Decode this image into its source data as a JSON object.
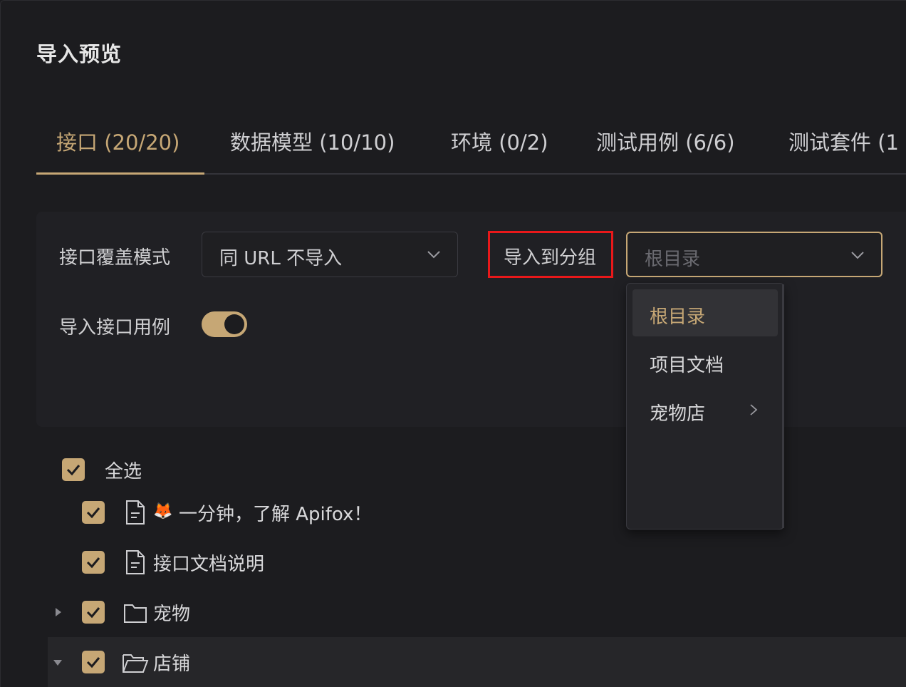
{
  "dialog": {
    "title": "导入预览"
  },
  "tabs": [
    {
      "label": "接口 (20/20)",
      "active": true
    },
    {
      "label": "数据模型 (10/10)",
      "active": false
    },
    {
      "label": "环境 (0/2)",
      "active": false
    },
    {
      "label": "测试用例 (6/6)",
      "active": false
    },
    {
      "label": "测试套件 (1"
    }
  ],
  "settings": {
    "override_mode_label": "接口覆盖模式",
    "override_mode_value": "同 URL 不导入",
    "import_group_label": "导入到分组",
    "import_group_placeholder": "根目录",
    "import_cases_label": "导入接口用例",
    "import_cases_enabled": true
  },
  "dropdown": {
    "items": [
      {
        "label": "根目录",
        "selected": true
      },
      {
        "label": "项目文档",
        "selected": false
      },
      {
        "label": "宠物店",
        "has_submenu": true
      }
    ]
  },
  "tree": {
    "select_all": "全选",
    "items": [
      {
        "label": "一分钟，了解 Apifox！",
        "emoji": "🦊",
        "type": "doc",
        "checked": true
      },
      {
        "label": "接口文档说明",
        "type": "doc",
        "checked": true
      },
      {
        "label": "宠物",
        "type": "folder",
        "checked": true,
        "expanded": false
      },
      {
        "label": "店铺",
        "type": "folder",
        "checked": true,
        "expanded": true
      }
    ]
  },
  "colors": {
    "accent": "#c6a775",
    "highlight": "#e8181a",
    "background": "#1c1c1f"
  }
}
